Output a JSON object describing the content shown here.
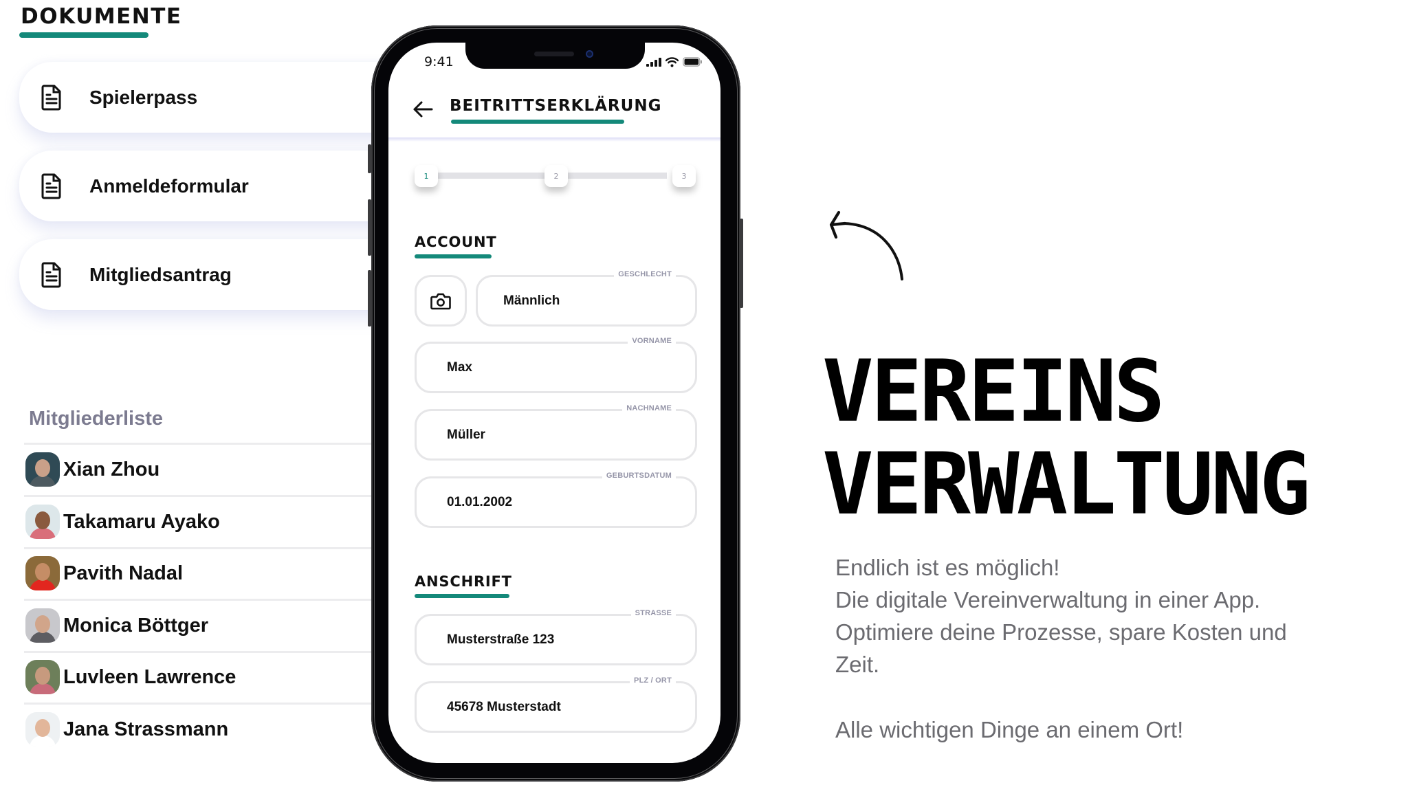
{
  "documents": {
    "title": "DOKUMENTE",
    "items": [
      {
        "label": "Spielerpass",
        "icon": "document-icon"
      },
      {
        "label": "Anmeldeformular",
        "icon": "document-icon"
      },
      {
        "label": "Mitgliedsantrag",
        "icon": "document-icon"
      }
    ]
  },
  "members": {
    "title": "Mitgliederliste",
    "items": [
      {
        "name": "Xian Zhou",
        "avatar_colors": [
          "#2f4a55",
          "#c9a089",
          "#4d5a60"
        ]
      },
      {
        "name": "Takamaru Ayako",
        "avatar_colors": [
          "#dde7ea",
          "#8a5a3e",
          "#d96e7a"
        ]
      },
      {
        "name": "Pavith Nadal",
        "avatar_colors": [
          "#8b6a3a",
          "#c58d66",
          "#e2261f"
        ]
      },
      {
        "name": "Monica Böttger",
        "avatar_colors": [
          "#c8c8cc",
          "#d1a58a",
          "#5d5d62"
        ]
      },
      {
        "name": "Luvleen Lawrence",
        "avatar_colors": [
          "#6d7f5a",
          "#c79a7e",
          "#c86b7a"
        ]
      },
      {
        "name": "Jana Strassmann",
        "avatar_colors": [
          "#eef1f3",
          "#e2b69a",
          "#ffffff"
        ]
      }
    ]
  },
  "phone": {
    "status_time": "9:41",
    "header_title": "BEITRITTSERKLÄRUNG",
    "steps": [
      "1",
      "2",
      "3"
    ],
    "active_step": 1,
    "account": {
      "title": "ACCOUNT",
      "photo_button_icon": "camera-icon",
      "fields": {
        "geschlecht": {
          "label": "GESCHLECHT",
          "value": "Männlich"
        },
        "vorname": {
          "label": "VORNAME",
          "value": "Max"
        },
        "nachname": {
          "label": "NACHNAME",
          "value": "Müller"
        },
        "geburtsdatum": {
          "label": "GEBURTSDATUM",
          "value": "01.01.2002"
        }
      }
    },
    "address": {
      "title": "ANSCHRIFT",
      "fields": {
        "strasse": {
          "label": "STRASSE",
          "value": "Musterstraße 123"
        },
        "plz_ort": {
          "label": "PLZ / ORT",
          "value": "45678 Musterstadt"
        }
      }
    }
  },
  "hero": {
    "title_line1": "VEREINS",
    "title_line2": "VERWALTUNG",
    "paragraph_lines": [
      "Endlich ist es möglich!",
      "Die digitale Vereinverwaltung in einer App.",
      "Optimiere deine Prozesse, spare Kosten und",
      "Zeit."
    ],
    "tagline": "Alle wichtigen Dinge an einem Ort!"
  },
  "colors": {
    "accent": "#14897a",
    "muted_heading": "#7c7b90",
    "body_text": "#6b6b70"
  }
}
